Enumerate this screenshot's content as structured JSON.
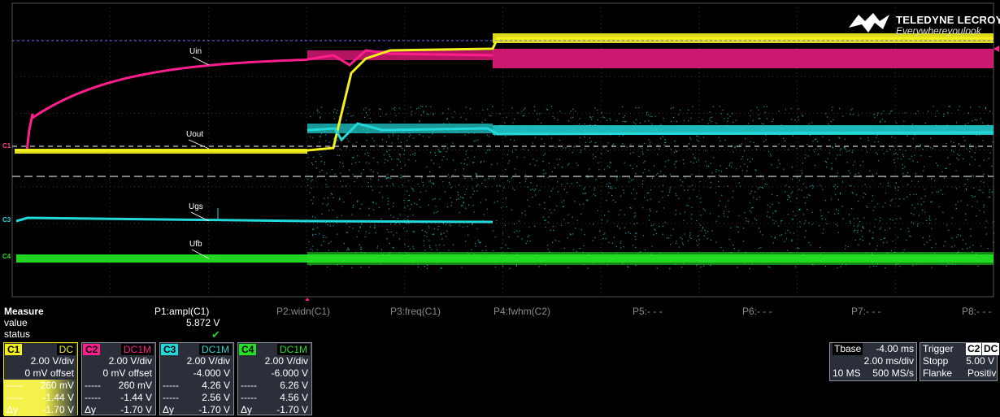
{
  "logo": {
    "brand": "TELEDYNE LECROY",
    "tagline": "Everywhereyoulook"
  },
  "traces": {
    "labels": [
      "Uin",
      "Uout",
      "Ugs",
      "Ufb"
    ],
    "channel_markers": [
      "C1",
      "C3",
      "C4"
    ],
    "colors": {
      "c1": "#f4f01e",
      "c2": "#ff1e8c",
      "c3": "#22d8d8",
      "c4": "#22e022"
    }
  },
  "measure": {
    "title": "Measure",
    "row_value": "value",
    "row_status": "status",
    "params": [
      {
        "label": "P1:ampl(C1)",
        "value": "5.872 V"
      },
      {
        "label": "P2:widn(C1)",
        "value": ""
      },
      {
        "label": "P3:freq(C1)",
        "value": ""
      },
      {
        "label": "P4:fwhm(C2)",
        "value": ""
      },
      {
        "label": "P5:- - -",
        "value": ""
      },
      {
        "label": "P6:- - -",
        "value": ""
      },
      {
        "label": "P7:- - -",
        "value": ""
      },
      {
        "label": "P8:- - -",
        "value": ""
      }
    ]
  },
  "channels": [
    {
      "name": "C1",
      "coupling": "DC",
      "vdiv": "2.00 V/div",
      "offset": "0 mV offset",
      "r1": "260 mV",
      "r2": "-1.44 V",
      "dy_label": "Δy",
      "dy": "-1.70 V"
    },
    {
      "name": "C2",
      "coupling": "DC1M",
      "vdiv": "2.00 V/div",
      "offset": "0 mV offset",
      "r1": "260 mV",
      "r2": "-1.44 V",
      "dy_label": "Δy",
      "dy": "-1.70 V"
    },
    {
      "name": "C3",
      "coupling": "DC1M",
      "vdiv": "2.00 V/div",
      "offset": "-4.000 V",
      "r1": "4.26 V",
      "r2": "2.56 V",
      "dy_label": "Δy",
      "dy": "-1.70 V"
    },
    {
      "name": "C4",
      "coupling": "DC1M",
      "vdiv": "2.00 V/div",
      "offset": "-6.000 V",
      "r1": "6.26 V",
      "r2": "4.56 V",
      "dy_label": "Δy",
      "dy": "-1.70 V"
    }
  ],
  "timebase": {
    "label": "Tbase",
    "delay": "-4.00 ms",
    "tdiv": "2.00 ms/div",
    "points": "10 MS",
    "rate": "500 MS/s"
  },
  "trigger": {
    "label": "Trigger",
    "src": "C2",
    "cpl": "DC",
    "mode": "Stopp",
    "level": "5.00 V",
    "edge_label": "Flanke",
    "slope": "Positiv"
  }
}
